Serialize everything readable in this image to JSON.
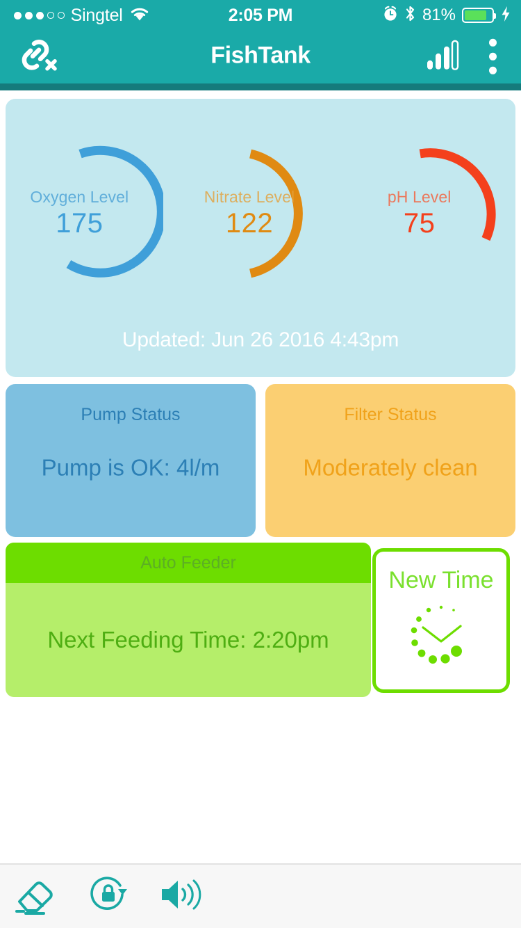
{
  "status_bar": {
    "carrier": "Singtel",
    "signal_dots_filled": 3,
    "signal_dots_total": 5,
    "wifi_icon": "wifi-icon",
    "time": "2:05 PM",
    "alarm_icon": "alarm-clock-icon",
    "bluetooth_icon": "bluetooth-icon",
    "battery_percent": "81%",
    "battery_fill_ratio": 0.81,
    "charging_icon": "lightning-bolt-icon",
    "background_color": "#1aaaa8",
    "text_color": "#ffffff"
  },
  "nav_bar": {
    "title": "FishTank",
    "left_icon": "broken-link-icon",
    "right_icons": [
      "signal-bars-icon",
      "overflow-menu-icon"
    ],
    "background_color": "#1aaaa8",
    "underline_color": "#157b7c"
  },
  "gauges": {
    "card_background": "#c3e8ef",
    "updated_text": "Updated: Jun 26 2016 4:43pm",
    "items": [
      {
        "label": "Oxygen Level",
        "value": "175",
        "color": "#3f9fd9",
        "arc_start_deg": -100,
        "arc_sweep_deg": 292
      },
      {
        "label": "Nitrate Level",
        "value": "122",
        "color": "#e08a12",
        "arc_start_deg": -100,
        "arc_sweep_deg": 200
      },
      {
        "label": "pH Level",
        "value": "75",
        "color": "#f4401c",
        "arc_start_deg": -100,
        "arc_sweep_deg": 126
      }
    ]
  },
  "status_cards": [
    {
      "title": "Pump Status",
      "value": "Pump is OK: 4l/m",
      "background_color": "#7ec0e0",
      "text_color": "#2c7fb5"
    },
    {
      "title": "Filter Status",
      "value": "Moderately clean",
      "background_color": "#fbcf72",
      "text_color": "#f0a21a"
    }
  ],
  "feeder": {
    "title": "Auto Feeder",
    "next_feeding": "Next Feeding Time: 2:20pm",
    "header_color": "#6ddd00",
    "body_color": "#b5ee6a",
    "text_color": "#4eae12"
  },
  "new_time_button": {
    "label": "New Time",
    "icon": "clock-dots-icon",
    "border_color": "#6ddd00",
    "text_color": "#7ae02e"
  },
  "toolbar": {
    "background_color": "#f7f7f7",
    "icon_color": "#1aa9a4",
    "buttons": [
      {
        "icon": "eraser-icon",
        "name": "eraser"
      },
      {
        "icon": "screen-lock-rotation-icon",
        "name": "screen-lock"
      },
      {
        "icon": "volume-speaker-icon",
        "name": "volume"
      }
    ]
  }
}
